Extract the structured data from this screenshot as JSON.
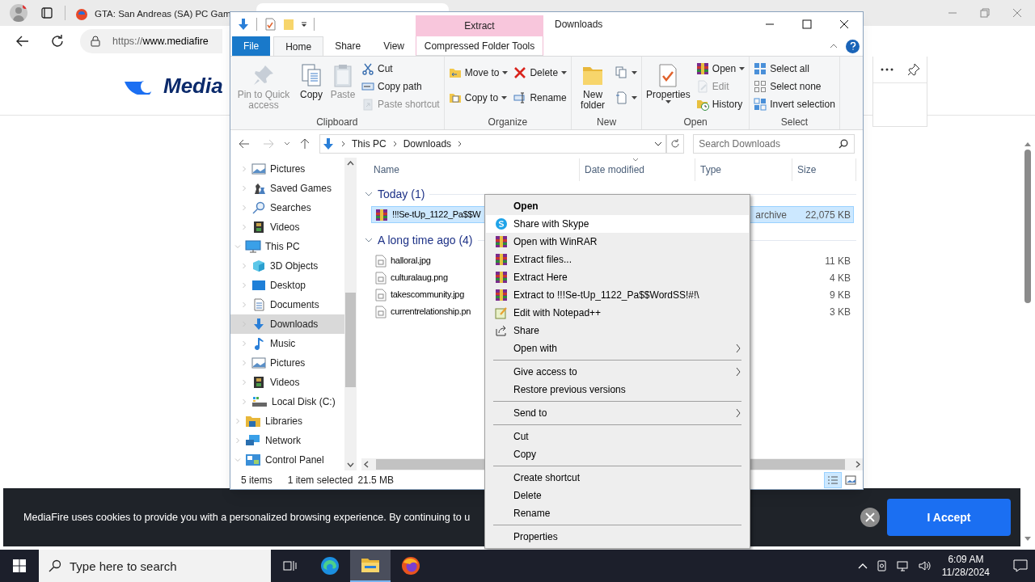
{
  "browser": {
    "tabs": [
      {
        "title": "GTA: San Andreas (SA) PC Gam",
        "selected": false
      },
      {
        "selected": true
      }
    ],
    "address": {
      "scheme": "https://",
      "host": "www.mediafire"
    },
    "page": {
      "logo": "Media",
      "cookie_text": "MediaFire uses cookies to provide you with a personalized browsing experience. By continuing to u",
      "cookie_button": "I Accept"
    }
  },
  "explorer": {
    "title": "Downloads",
    "contextual_group": "Extract",
    "tabs": [
      {
        "label": "File",
        "kind": "file",
        "selected": false
      },
      {
        "label": "Home",
        "kind": "normal",
        "selected": true
      },
      {
        "label": "Share",
        "kind": "normal",
        "selected": false
      },
      {
        "label": "View",
        "kind": "normal",
        "selected": false
      },
      {
        "label": "Compressed Folder Tools",
        "kind": "contextual",
        "selected": false
      }
    ],
    "ribbon": [
      {
        "label": "Clipboard",
        "items": [
          {
            "kind": "large",
            "label": "Pin to Quick access",
            "disabled": true,
            "dropdown": false
          },
          {
            "kind": "large",
            "label": "Copy",
            "disabled": false,
            "dropdown": false
          },
          {
            "kind": "large",
            "label": "Paste",
            "disabled": true,
            "dropdown": false
          },
          {
            "kind": "stack",
            "buttons": [
              {
                "label": "Cut",
                "disabled": false,
                "dropdown": false
              },
              {
                "label": "Copy path",
                "disabled": false,
                "dropdown": false
              },
              {
                "label": "Paste shortcut",
                "disabled": true,
                "dropdown": false
              }
            ]
          }
        ]
      },
      {
        "label": "Organize",
        "items": [
          {
            "kind": "stack",
            "buttons": [
              {
                "label": "Move to",
                "disabled": false,
                "dropdown": true
              },
              {
                "label": "Copy to",
                "disabled": false,
                "dropdown": true
              }
            ]
          },
          {
            "kind": "stack",
            "buttons": [
              {
                "label": "Delete",
                "disabled": false,
                "dropdown": true
              },
              {
                "label": "Rename",
                "disabled": false,
                "dropdown": false
              }
            ]
          }
        ]
      },
      {
        "label": "New",
        "items": [
          {
            "kind": "large",
            "label": "New folder",
            "disabled": false,
            "dropdown": false
          },
          {
            "kind": "stack",
            "buttons": [
              {
                "disabled": false,
                "dropdown": true
              },
              {
                "disabled": false,
                "dropdown": true
              }
            ]
          }
        ]
      },
      {
        "label": "Open",
        "items": [
          {
            "kind": "large",
            "label": "Properties",
            "disabled": false,
            "dropdown": true
          },
          {
            "kind": "stack",
            "buttons": [
              {
                "label": "Open",
                "disabled": false,
                "dropdown": true
              },
              {
                "label": "Edit",
                "disabled": true,
                "dropdown": false
              },
              {
                "label": "History",
                "disabled": false,
                "dropdown": false
              }
            ]
          }
        ]
      },
      {
        "label": "Select",
        "items": [
          {
            "kind": "stack",
            "buttons": [
              {
                "label": "Select all",
                "disabled": false,
                "dropdown": false
              },
              {
                "label": "Select none",
                "disabled": false,
                "dropdown": false
              },
              {
                "label": "Invert selection",
                "disabled": false,
                "dropdown": false
              }
            ]
          }
        ]
      }
    ],
    "breadcrumb": [
      "This PC",
      "Downloads"
    ],
    "search": {
      "placeholder": "Search Downloads"
    },
    "nav_tree": [
      {
        "children": [
          {
            "label": "Pictures",
            "kind": "pictures",
            "expanded": false,
            "selected": false
          },
          {
            "label": "Saved Games",
            "kind": "games",
            "expanded": false,
            "selected": false
          },
          {
            "label": "Searches",
            "kind": "search",
            "expanded": false,
            "selected": false
          },
          {
            "label": "Videos",
            "kind": "videos",
            "expanded": false,
            "selected": false
          }
        ]
      },
      {
        "label": "This PC",
        "kind": "pc",
        "expanded": true,
        "selected": false,
        "children": [
          {
            "label": "3D Objects",
            "kind": "objects",
            "expanded": false,
            "selected": false
          },
          {
            "label": "Desktop",
            "kind": "desktop",
            "expanded": false,
            "selected": false
          },
          {
            "label": "Documents",
            "kind": "documents",
            "expanded": false,
            "selected": false
          },
          {
            "label": "Downloads",
            "kind": "downloads",
            "expanded": false,
            "selected": true
          },
          {
            "label": "Music",
            "kind": "music",
            "expanded": false,
            "selected": false
          },
          {
            "label": "Pictures",
            "kind": "pictures",
            "expanded": false,
            "selected": false
          },
          {
            "label": "Videos",
            "kind": "videos",
            "expanded": false,
            "selected": false
          },
          {
            "label": "Local Disk (C:)",
            "kind": "disk",
            "expanded": false,
            "selected": false
          }
        ]
      },
      {
        "label": "Libraries",
        "kind": "libraries",
        "expanded": false,
        "selected": false
      },
      {
        "label": "Network",
        "kind": "network",
        "expanded": false,
        "selected": false
      },
      {
        "label": "Control Panel",
        "kind": "control",
        "expanded": true,
        "selected": false
      }
    ],
    "columns": [
      "Name",
      "Date modified",
      "Type",
      "Size"
    ],
    "groups": [
      {
        "label": "Today (1)",
        "expanded": true,
        "files": [
          {
            "name": "!!!Se-tUp_1122_Pa$$W",
            "kind": "archive",
            "type": "archive",
            "size": "22,075 KB",
            "selected": true
          }
        ]
      },
      {
        "label": "A long time ago (4)",
        "expanded": true,
        "files": [
          {
            "name": "halloral.jpg",
            "kind": "image",
            "size": "11 KB",
            "selected": false
          },
          {
            "name": "culturalaug.png",
            "kind": "image",
            "size": "4 KB",
            "selected": false
          },
          {
            "name": "takescommunity.jpg",
            "kind": "image",
            "size": "9 KB",
            "selected": false
          },
          {
            "name": "currentrelationship.pn",
            "kind": "image",
            "size": "3 KB",
            "selected": false
          }
        ]
      }
    ],
    "status": {
      "count": "5 items",
      "selection": "1 item selected",
      "size": "21.5 MB"
    },
    "view_modes": [
      {
        "kind": "details",
        "selected": true
      },
      {
        "kind": "large",
        "selected": false
      }
    ]
  },
  "context_menu": [
    {
      "kind": "plain",
      "label": "Open",
      "default": true,
      "selected": false
    },
    {
      "kind": "skype",
      "label": "Share with Skype",
      "default": false,
      "selected": true
    },
    {
      "kind": "winrar",
      "label": "Open with WinRAR",
      "default": false,
      "selected": false
    },
    {
      "kind": "winrar",
      "label": "Extract files...",
      "default": false,
      "selected": false
    },
    {
      "kind": "winrar",
      "label": "Extract Here",
      "default": false,
      "selected": false
    },
    {
      "kind": "winrar",
      "label": "Extract to !!!Se-tUp_1122_Pa$$WordSS!#!\\",
      "default": false,
      "selected": false
    },
    {
      "kind": "notepad",
      "label": "Edit with Notepad++",
      "default": false,
      "selected": false
    },
    {
      "kind": "share",
      "label": "Share",
      "default": false,
      "selected": false
    },
    {
      "kind": "submenu",
      "label": "Open with",
      "default": false,
      "selected": false
    },
    {
      "kind": "separator"
    },
    {
      "kind": "submenu",
      "label": "Give access to",
      "default": false,
      "selected": false
    },
    {
      "kind": "plain",
      "label": "Restore previous versions",
      "default": false,
      "selected": false
    },
    {
      "kind": "separator"
    },
    {
      "kind": "submenu",
      "label": "Send to",
      "default": false,
      "selected": false
    },
    {
      "kind": "separator"
    },
    {
      "kind": "plain",
      "label": "Cut",
      "default": false,
      "selected": false
    },
    {
      "kind": "plain",
      "label": "Copy",
      "default": false,
      "selected": false
    },
    {
      "kind": "separator"
    },
    {
      "kind": "plain",
      "label": "Create shortcut",
      "default": false,
      "selected": false
    },
    {
      "kind": "plain",
      "label": "Delete",
      "default": false,
      "selected": false
    },
    {
      "kind": "plain",
      "label": "Rename",
      "default": false,
      "selected": false
    },
    {
      "kind": "separator"
    },
    {
      "kind": "plain",
      "label": "Properties",
      "default": false,
      "selected": false
    }
  ],
  "taskbar": {
    "search_placeholder": "Type here to search",
    "apps": [
      {
        "kind": "edge",
        "selected": false
      },
      {
        "kind": "explorer",
        "selected": true
      },
      {
        "kind": "firefox",
        "selected": false
      }
    ],
    "time": "6:09 AM",
    "date": "11/28/2024"
  }
}
